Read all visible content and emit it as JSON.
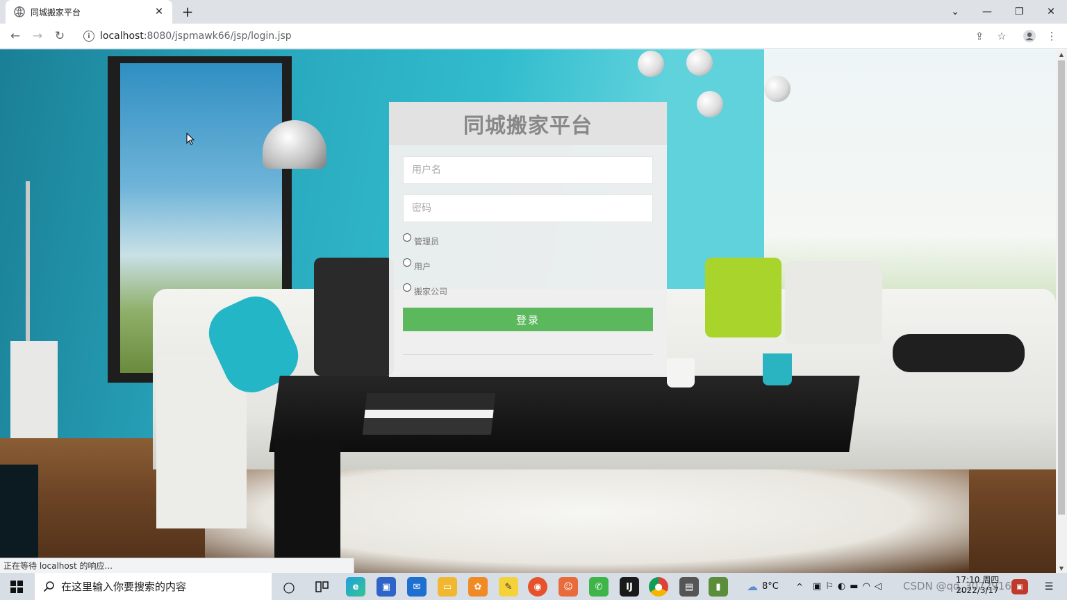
{
  "browser": {
    "tab_title": "同城搬家平台",
    "new_tab_label": "+",
    "url_host": "localhost",
    "url_rest": ":8080/jspmawk66/jsp/login.jsp",
    "status_text": "正在等待 localhost 的响应..."
  },
  "login": {
    "title": "同城搬家平台",
    "username_placeholder": "用户名",
    "password_placeholder": "密码",
    "roles": [
      "管理员",
      "用户",
      "搬家公司"
    ],
    "submit_label": "登录",
    "submit_color": "#5cb85c"
  },
  "taskbar": {
    "search_placeholder": "在这里输入你要搜索的内容",
    "weather": "8°C",
    "time": "17:10 周四",
    "date": "2022/3/17",
    "watermark": "CSDN @qq_307291663"
  }
}
